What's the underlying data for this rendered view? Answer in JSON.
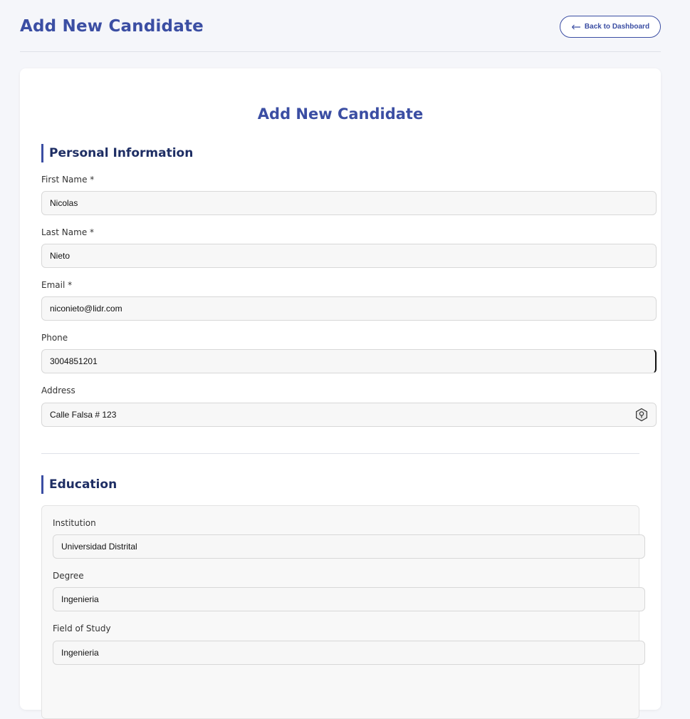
{
  "header": {
    "title": "Add New Candidate",
    "back_label": "Back to Dashboard"
  },
  "form": {
    "title": "Add New Candidate",
    "personal": {
      "heading": "Personal Information",
      "first_name": {
        "label": "First Name *",
        "value": "Nicolas"
      },
      "last_name": {
        "label": "Last Name *",
        "value": "Nieto"
      },
      "email": {
        "label": "Email *",
        "value": "niconieto@lidr.com"
      },
      "phone": {
        "label": "Phone",
        "value": "3004851201"
      },
      "address": {
        "label": "Address",
        "value": "Calle Falsa # 123",
        "icon": "location-hexagon-icon"
      }
    },
    "education": {
      "heading": "Education",
      "institution": {
        "label": "Institution",
        "value": "Universidad Distrital"
      },
      "degree": {
        "label": "Degree",
        "value": "Ingenieria"
      },
      "field_of_study": {
        "label": "Field of Study",
        "value": "Ingenieria"
      }
    }
  },
  "colors": {
    "accent": "#3b4ea3",
    "heading": "#1e2e64",
    "background": "#f5f6fa"
  }
}
